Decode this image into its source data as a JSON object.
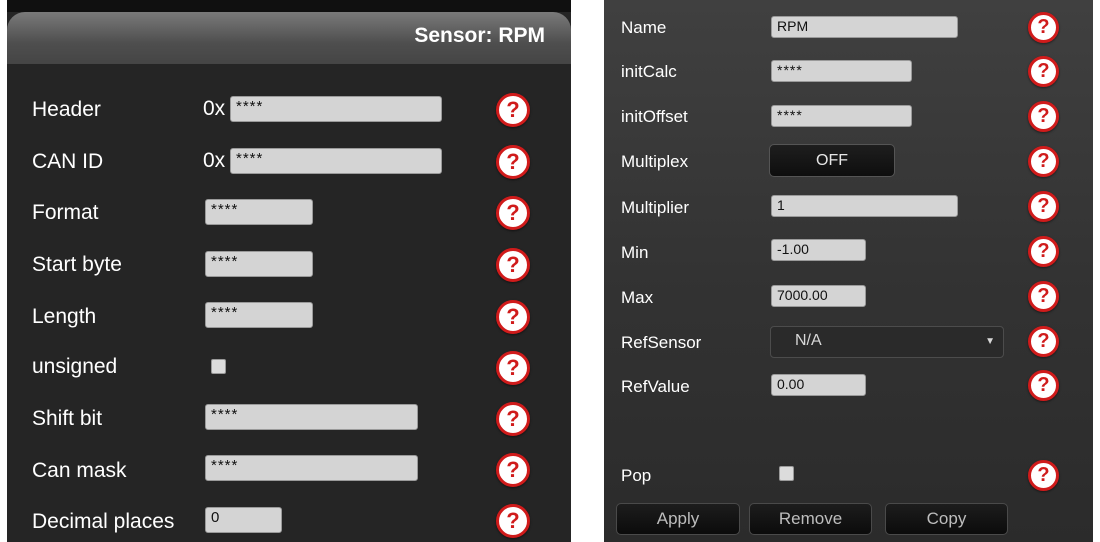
{
  "sensor_panel": {
    "title": "Sensor: RPM",
    "header": {
      "label": "Header",
      "prefix": "0x",
      "value": "****"
    },
    "can_id": {
      "label": "CAN ID",
      "prefix": "0x",
      "value": "****"
    },
    "format": {
      "label": "Format",
      "value": "****"
    },
    "start_byte": {
      "label": "Start byte",
      "value": "****"
    },
    "length": {
      "label": "Length",
      "value": "****"
    },
    "unsigned": {
      "label": "unsigned",
      "checked": false
    },
    "shift_bit": {
      "label": "Shift bit",
      "value": "****"
    },
    "can_mask": {
      "label": "Can mask",
      "value": "****"
    },
    "decimal_places": {
      "label": "Decimal places",
      "value": "0"
    }
  },
  "settings_panel": {
    "name": {
      "label": "Name",
      "value": "RPM"
    },
    "init_calc": {
      "label": "initCalc",
      "value": "****"
    },
    "init_offset": {
      "label": "initOffset",
      "value": "****"
    },
    "multiplex": {
      "label": "Multiplex",
      "state": "OFF"
    },
    "multiplier": {
      "label": "Multiplier",
      "value": "1"
    },
    "min": {
      "label": "Min",
      "value": "-1.00"
    },
    "max": {
      "label": "Max",
      "value": "7000.00"
    },
    "ref_sensor": {
      "label": "RefSensor",
      "selected": "N/A"
    },
    "ref_value": {
      "label": "RefValue",
      "value": "0.00"
    },
    "pop": {
      "label": "Pop",
      "checked": false
    },
    "buttons": {
      "apply": "Apply",
      "remove": "Remove",
      "copy": "Copy"
    }
  },
  "help_icon_glyph": "?",
  "colors": {
    "help_ring": "#d01b1b",
    "field_bg": "#d4d4d4",
    "panel_bg": "#252525"
  }
}
